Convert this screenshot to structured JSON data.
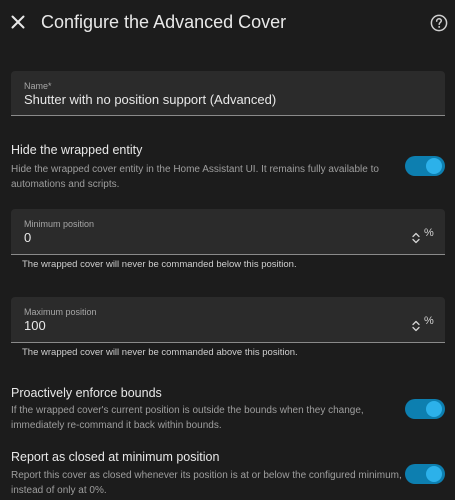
{
  "header": {
    "title": "Configure the Advanced Cover"
  },
  "name_field": {
    "label": "Name*",
    "value": "Shutter with no position support (Advanced)"
  },
  "hide_entity": {
    "title": "Hide the wrapped entity",
    "description": "Hide the wrapped cover entity in the Home Assistant UI. It remains fully available to automations and scripts.",
    "enabled": true
  },
  "min_position": {
    "label": "Minimum position",
    "value": "0",
    "suffix": "%",
    "helper": "The wrapped cover will never be commanded below this position."
  },
  "max_position": {
    "label": "Maximum position",
    "value": "100",
    "suffix": "%",
    "helper": "The wrapped cover will never be commanded above this position."
  },
  "enforce_bounds": {
    "title": "Proactively enforce bounds",
    "description": "If the wrapped cover's current position is outside the bounds when they change, immediately re-command it back within bounds.",
    "enabled": true
  },
  "report_closed": {
    "title": "Report as closed at minimum position",
    "description": "Report this cover as closed whenever its position is at or below the configured minimum, instead of only at 0%.",
    "enabled": true
  },
  "icons": {
    "close": "close-icon",
    "help": "help-circle-icon",
    "stepper": "unfold-icon"
  },
  "colors": {
    "background": "#1c1c1c",
    "field_background": "#2b2b2b",
    "toggle_track": "#0d7fb0",
    "toggle_knob": "#2cb1ea"
  }
}
